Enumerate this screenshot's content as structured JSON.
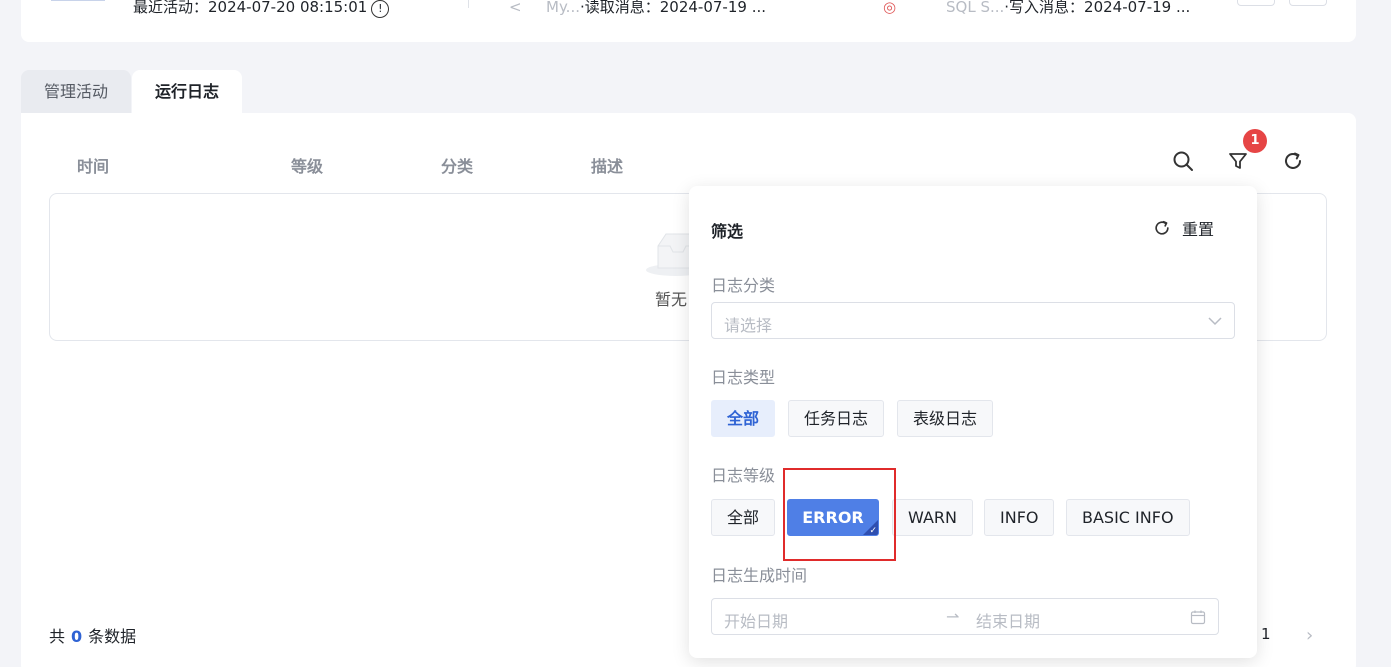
{
  "header_card": {
    "last_active": "最近活动：2024-07-20 08:15:01",
    "info_glyph": "!",
    "source_a": "My...",
    "read_message": "·读取消息：2024-07-19 ...",
    "source_b": "SQL S...",
    "write_message": "·写入消息：2024-07-19 ..."
  },
  "tabs": [
    {
      "label": "管理活动",
      "active": false
    },
    {
      "label": "运行日志",
      "active": true
    }
  ],
  "table": {
    "columns": [
      "时间",
      "等级",
      "分类",
      "描述"
    ],
    "empty_text": "暂无"
  },
  "toolbar": {
    "filter_badge": "1",
    "icons": [
      "search-icon",
      "filter-icon",
      "refresh-icon"
    ]
  },
  "footer": {
    "total_prefix": "共",
    "total_count": "0",
    "total_suffix": "条数据",
    "current_page": "1"
  },
  "filter": {
    "title": "筛选",
    "reset_label": "重置",
    "category_label": "日志分类",
    "category_placeholder": "请选择",
    "type_label": "日志类型",
    "type_options": [
      "全部",
      "任务日志",
      "表级日志"
    ],
    "type_selected": "全部",
    "level_label": "日志等级",
    "level_options": [
      "全部",
      "ERROR",
      "WARN",
      "INFO",
      "BASIC INFO"
    ],
    "level_selected": "ERROR",
    "time_label": "日志生成时间",
    "start_placeholder": "开始日期",
    "end_placeholder": "结束日期"
  },
  "colors": {
    "accent": "#4f7fe6",
    "badge": "#e64545",
    "highlight_box": "#e02b2b"
  }
}
